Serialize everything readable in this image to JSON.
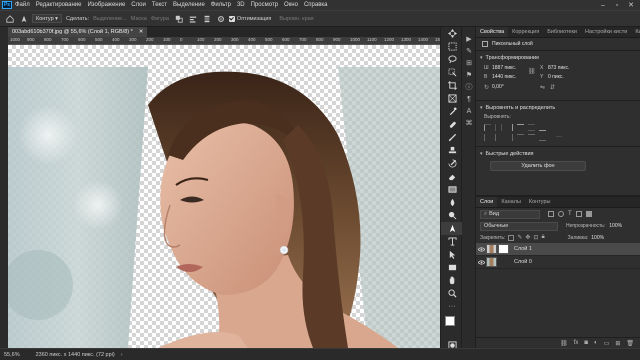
{
  "app": {
    "logo": "Ps"
  },
  "menu": {
    "items": [
      "Файл",
      "Редактирование",
      "Изображение",
      "Слои",
      "Текст",
      "Выделение",
      "Фильтр",
      "3D",
      "Просмотр",
      "Окно",
      "Справка"
    ]
  },
  "options_bar": {
    "mode_value": "Контур",
    "make_label": "Сделать:",
    "selection_label": "Выделение...",
    "mask_label": "Маска",
    "shape_label": "Фигура",
    "autoalign_label": "Выровн. края",
    "optimization_label": "Оптимизация"
  },
  "document": {
    "tab_title": "003abd610b370f.jpg @ 55,6% (Слой 1, RGB/8) *",
    "ruler_marks": [
      "1000",
      "900",
      "800",
      "700",
      "600",
      "500",
      "400",
      "300",
      "200",
      "100",
      "0",
      "100",
      "200",
      "300",
      "400",
      "500",
      "600",
      "700",
      "800",
      "900",
      "1000",
      "1100",
      "1200",
      "1300",
      "1400",
      "1500",
      "1600",
      "1700",
      "1800",
      "1900",
      "2000",
      "2100",
      "2200",
      "2300",
      "2400",
      "2500",
      "2600",
      "2700",
      "2800",
      "2900",
      "3000",
      "3100",
      "3200"
    ]
  },
  "status": {
    "zoom": "55,6%",
    "doc_info": "2360 пикс. x 1440 пикс. (72 ppi)"
  },
  "properties_panel": {
    "tabs": [
      "Свойства",
      "Коррекция",
      "Библиотеки",
      "Настройки кисти",
      "Кисти"
    ],
    "layer_type": "Пиксельный слой",
    "transform_title": "Трансформирование",
    "w_label": "Ш",
    "w_value": "1887 пикс.",
    "h_label": "В",
    "h_value": "1440 пикс.",
    "x_label": "X",
    "x_value": "873 пикс.",
    "y_label": "Y",
    "y_value": "0 пикс.",
    "angle_value": "0,00°",
    "align_title": "Выровнять и распределить",
    "align_label": "Выровнять:",
    "quick_title": "Быстрые действия",
    "remove_bg_button": "Удалить фон"
  },
  "layers_panel": {
    "tabs": [
      "Слои",
      "Каналы",
      "Контуры"
    ],
    "filter_value": "Вид",
    "blend_mode": "Обычные",
    "opacity_label": "Непрозрачность:",
    "opacity_value": "100%",
    "lock_label": "Закрепить:",
    "fill_label": "Заливка:",
    "fill_value": "100%",
    "layers": [
      {
        "name": "Слой 1",
        "selected": true
      },
      {
        "name": "Слой 0",
        "selected": false
      }
    ]
  },
  "colors": {
    "accent": "#31a8ff",
    "fg_color": "#ffffff",
    "bg_color": "#000000"
  }
}
